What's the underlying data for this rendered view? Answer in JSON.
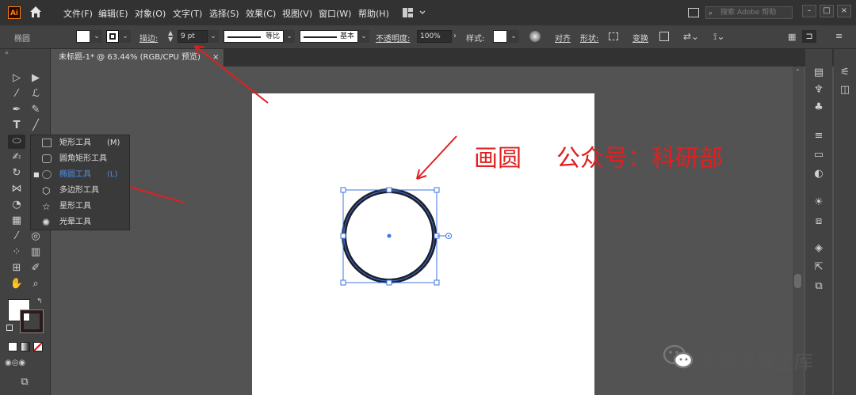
{
  "app": {
    "logo": "Ai"
  },
  "menu": [
    "文件(F)",
    "编辑(E)",
    "对象(O)",
    "文字(T)",
    "选择(S)",
    "效果(C)",
    "视图(V)",
    "窗口(W)",
    "帮助(H)"
  ],
  "search": {
    "placeholder": "搜索 Adobe 帮助"
  },
  "control": {
    "selection_label": "椭圆",
    "stroke_label": "描边:",
    "stroke_value": "9 pt",
    "profile_label": "等比",
    "brush_label": "基本",
    "opacity_label": "不透明度:",
    "opacity_value": "100%",
    "style_label": "样式:",
    "align_label": "对齐",
    "shape_label": "形状:",
    "transform_label": "变换"
  },
  "document_tab": {
    "title": "未标题-1* @ 63.44% (RGB/CPU 预览)",
    "close": "×"
  },
  "flyout": {
    "items": [
      {
        "label": "矩形工具",
        "key": "(M)",
        "icon": "rectangle-icon",
        "active": false
      },
      {
        "label": "圆角矩形工具",
        "key": "",
        "icon": "rounded-rectangle-icon",
        "active": false
      },
      {
        "label": "椭圆工具",
        "key": "(L)",
        "icon": "ellipse-icon",
        "active": true
      },
      {
        "label": "多边形工具",
        "key": "",
        "icon": "polygon-icon",
        "active": false
      },
      {
        "label": "星形工具",
        "key": "",
        "icon": "star-icon",
        "active": false
      },
      {
        "label": "光晕工具",
        "key": "",
        "icon": "flare-icon",
        "active": false
      }
    ]
  },
  "annotations": {
    "title": "画圆",
    "account": "公众号：科研部"
  },
  "watermark": {
    "text": "学霸资源宝库"
  },
  "colors": {
    "accent": "#3d74e0",
    "annotation_red": "#e02020"
  }
}
